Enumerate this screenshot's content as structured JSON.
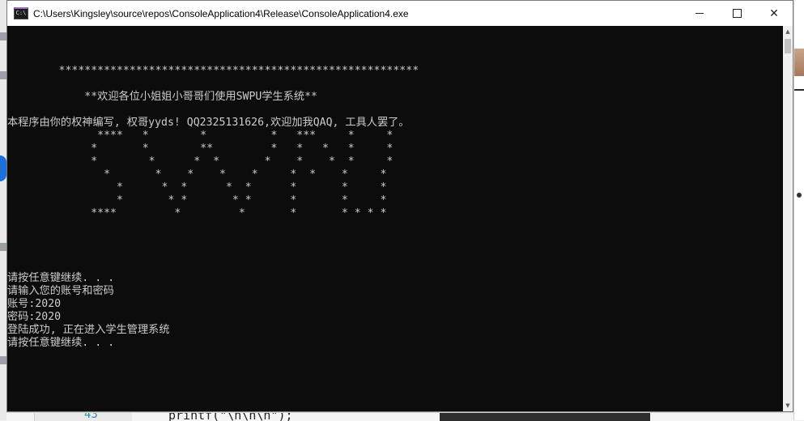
{
  "window": {
    "title": "C:\\Users\\Kingsley\\source\\repos\\ConsoleApplication4\\Release\\ConsoleApplication4.exe",
    "app_icon_text": "C:\\",
    "controls": {
      "close": "✕"
    }
  },
  "console": {
    "lines": [
      "",
      "",
      "",
      "        ********************************************************",
      "",
      "            **欢迎各位小姐姐小哥哥们使用SWPU学生系统**",
      "",
      "本程序由你的权神编写, 权哥yyds! QQ2325131626,欢迎加我QAQ, 工具人罢了。",
      "              ****   *        *          *   ***     *     *",
      "             *       *        **         *   *   *   *     *",
      "             *        *      *  *       *    *    *  *     *",
      "               *       *    *    *    *     *  *    *     *",
      "                 *      *  *      *  *      *       *     *",
      "                 *       * *       * *      *       *     *",
      "             ****         *         *       *       * * * *",
      "",
      "",
      "",
      "",
      "请按任意键继续. . .",
      "请输入您的账号和密码",
      "账号:2020",
      "密码:2020",
      "登陆成功, 正在进入学生管理系统",
      "请按任意键继续. . ."
    ]
  },
  "background": {
    "editor_line_number": "43",
    "editor_code": "printf(\"\\n\\n\\n\");"
  },
  "colors": {
    "console_bg": "#0c0c0c",
    "console_fg": "#cccccc",
    "titlebar_bg": "#ffffff"
  }
}
